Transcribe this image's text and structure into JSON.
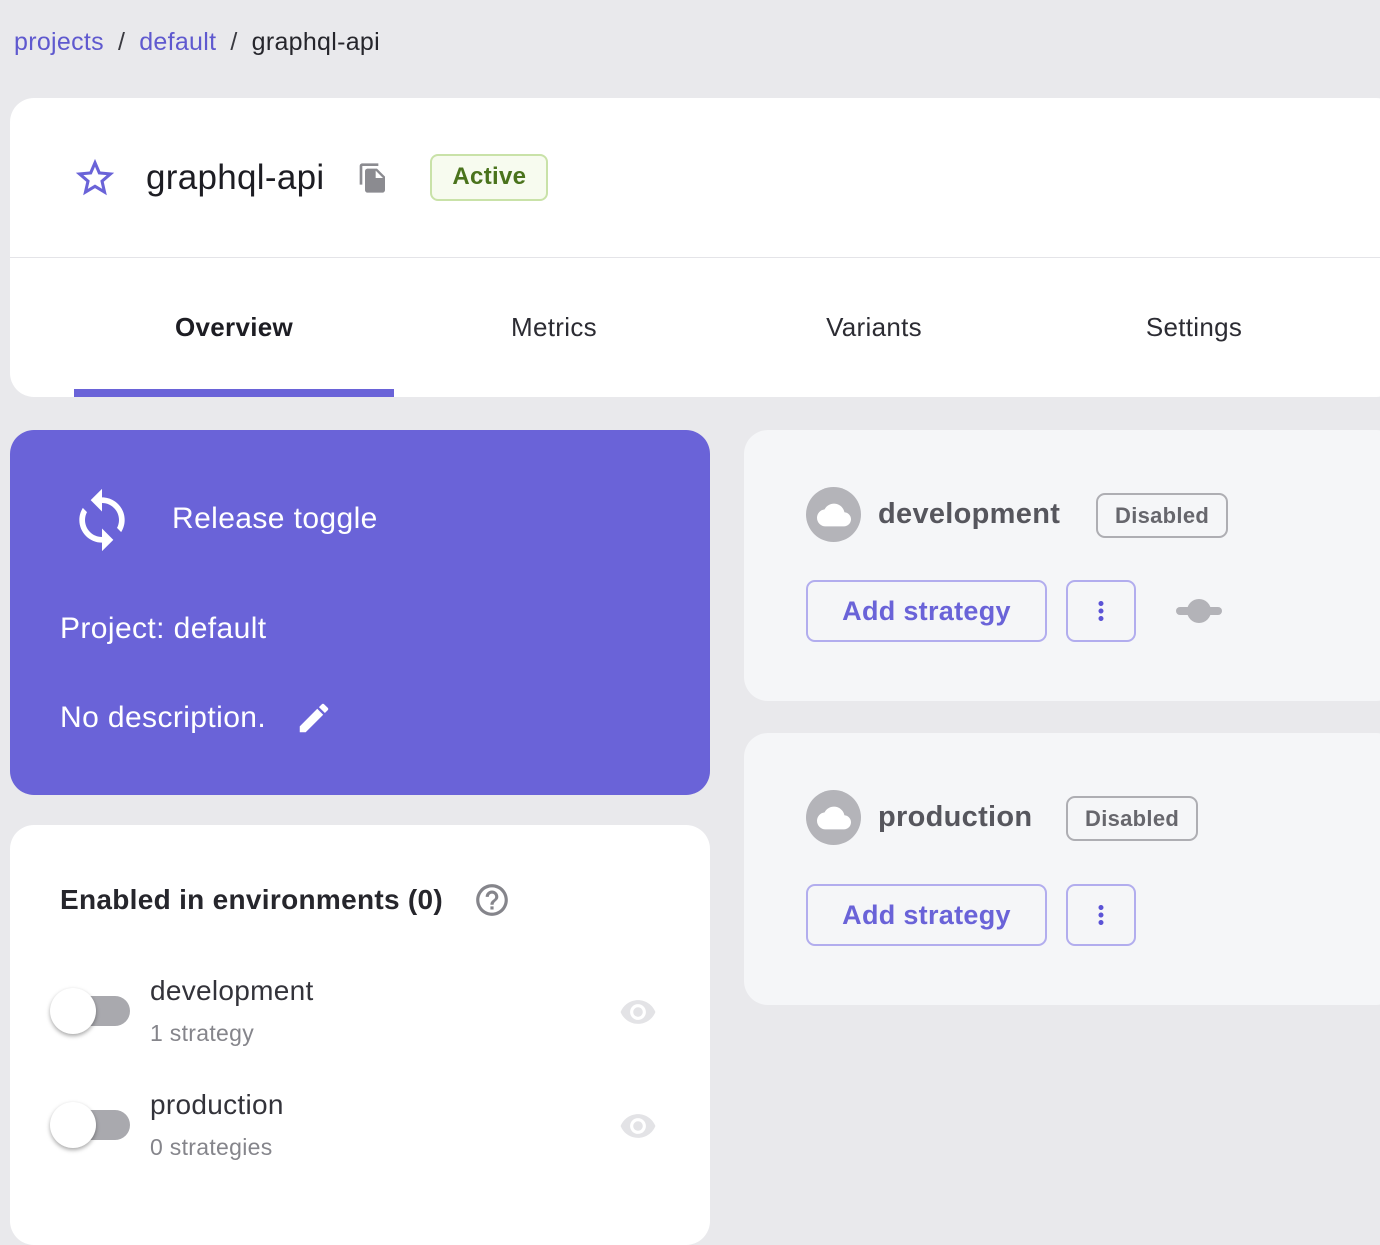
{
  "breadcrumb": {
    "separator": "/",
    "items": [
      {
        "label": "projects",
        "type": "link"
      },
      {
        "label": "default",
        "type": "link"
      },
      {
        "label": "graphql-api",
        "type": "current"
      }
    ]
  },
  "header": {
    "title": "graphql-api",
    "status_badge": "Active",
    "icons": {
      "favorite": "star-outline-icon",
      "copy": "copy-icon"
    }
  },
  "tabs": [
    {
      "label": "Overview",
      "active": true
    },
    {
      "label": "Metrics",
      "active": false
    },
    {
      "label": "Variants",
      "active": false
    },
    {
      "label": "Settings",
      "active": false
    }
  ],
  "toggle_info_card": {
    "type_icon": "loop-icon",
    "type_label": "Release toggle",
    "project_label": "Project: default",
    "description": "No description.",
    "edit_icon": "pencil-icon"
  },
  "enabled_panel": {
    "title": "Enabled in environments (0)",
    "help_icon": "help-circle-icon",
    "environments": [
      {
        "name": "development",
        "strategies": "1 strategy",
        "enabled": false
      },
      {
        "name": "production",
        "strategies": "0 strategies",
        "enabled": false
      }
    ]
  },
  "environment_cards": [
    {
      "name": "development",
      "status": "Disabled",
      "add_strategy_label": "Add strategy",
      "avatar_icon": "cloud-icon",
      "has_strategy_slider_icon": true
    },
    {
      "name": "production",
      "status": "Disabled",
      "add_strategy_label": "Add strategy",
      "avatar_icon": "cloud-icon",
      "has_strategy_slider_icon": false
    }
  ],
  "colors": {
    "accent_purple": "#6a63d8",
    "link_purple": "#5f59cf",
    "page_background": "#e9e9ec",
    "card_background": "#ffffff",
    "env_card_background": "#f5f6f8",
    "active_badge_text": "#4a731c",
    "active_badge_background": "#f7fbef",
    "active_badge_border": "#c9e2a8",
    "disabled_badge_text": "#67676d",
    "gray_icon": "#8b8b90",
    "light_eye_icon": "#e3e3e6"
  }
}
